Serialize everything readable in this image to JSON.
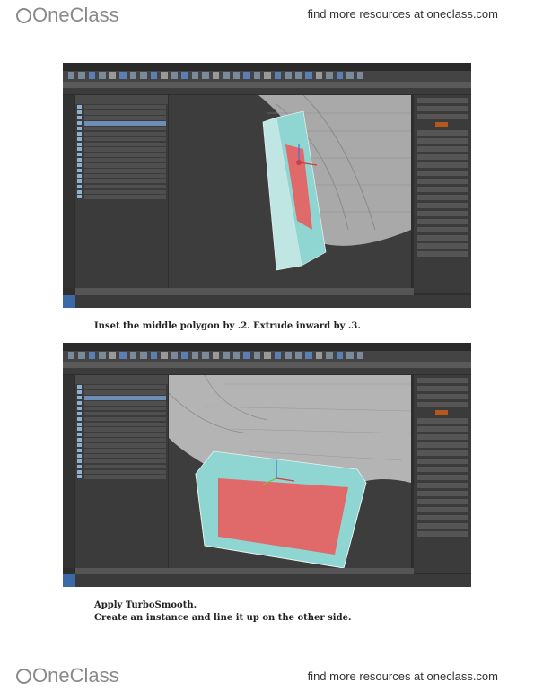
{
  "header": {
    "logo_text": "OneClass",
    "tagline": "find more resources at oneclass.com"
  },
  "footer": {
    "logo_text": "OneClass",
    "tagline": "find more resources at oneclass.com"
  },
  "screenshots": [
    {
      "caption_lines": [
        "Inset the middle polygon by .2. Extrude inward by .3."
      ]
    },
    {
      "caption_lines": [
        "Apply TurboSmooth.",
        "Create an instance and line it up on the other side."
      ]
    }
  ],
  "colors": {
    "mesh_cyan": "#8fd6d2",
    "face_red": "#e06a6a",
    "ui_dark": "#2e2e2e",
    "accent_orange": "#b35a1a"
  }
}
